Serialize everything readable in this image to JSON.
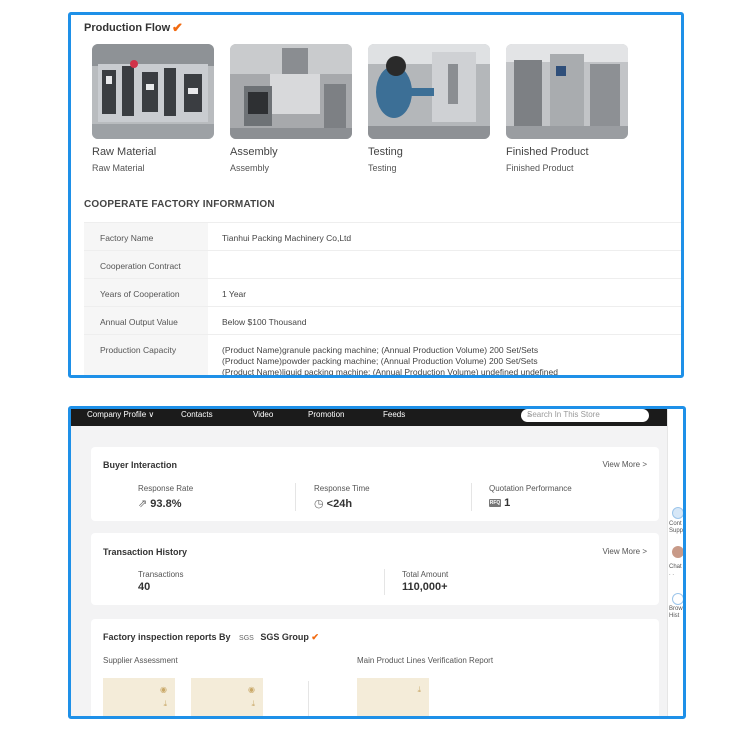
{
  "production_flow": {
    "title": "Production Flow",
    "verified_icon": "checkmark-icon",
    "steps": [
      {
        "label": "Raw Material",
        "sublabel": "Raw Material"
      },
      {
        "label": "Assembly",
        "sublabel": "Assembly"
      },
      {
        "label": "Testing",
        "sublabel": "Testing"
      },
      {
        "label": "Finished Product",
        "sublabel": "Finished Product"
      }
    ]
  },
  "cooperate_factory": {
    "title": "COOPERATE FACTORY INFORMATION",
    "rows": [
      {
        "key": "Factory Name",
        "value": "Tianhui Packing Machinery Co,Ltd"
      },
      {
        "key": "Cooperation Contract",
        "value": ""
      },
      {
        "key": "Years of Cooperation",
        "value": "1 Year"
      },
      {
        "key": "Annual Output Value",
        "value": "Below $100 Thousand"
      },
      {
        "key": "Production Capacity",
        "lines": [
          "(Product Name)granule packing machine; (Annual Production Volume) 200 Set/Sets",
          "(Product Name)powder packing machine; (Annual Production Volume) 200 Set/Sets",
          "(Product Name)liquid packing machine; (Annual Production Volume) undefined undefined"
        ]
      }
    ]
  },
  "nav": {
    "items": [
      "Company Profile",
      "Contacts",
      "Video",
      "Promotion",
      "Feeds"
    ],
    "search_placeholder": "Search In This Store"
  },
  "sidebar": {
    "contact": "Cont Supp",
    "chat": "Chat",
    "chat_sub": "∙ ∙",
    "browse": "Brow Hist"
  },
  "buyer_interaction": {
    "title": "Buyer Interaction",
    "view_more": "View More >",
    "metrics": [
      {
        "label": "Response Rate",
        "value": "93.8%",
        "icon": "share-arrow-icon"
      },
      {
        "label": "Response Time",
        "value": "<24h",
        "icon": "clock-icon"
      },
      {
        "label": "Quotation Performance",
        "value": "1",
        "icon": "rfq-icon"
      }
    ]
  },
  "transaction_history": {
    "title": "Transaction History",
    "view_more": "View More >",
    "metrics": [
      {
        "label": "Transactions",
        "value": "40"
      },
      {
        "label": "Total Amount",
        "value": "110,000+"
      }
    ]
  },
  "factory_inspection": {
    "title": "Factory inspection reports By",
    "sgs_logo": "SGS",
    "sgs_name": "SGS Group",
    "supplier_assessment": "Supplier Assessment",
    "main_product_report": "Main Product Lines Verification Report"
  },
  "colors": {
    "frame_blue": "#1e90e8",
    "accent_orange": "#f26a10",
    "nav_bg": "#1b1b1b"
  }
}
